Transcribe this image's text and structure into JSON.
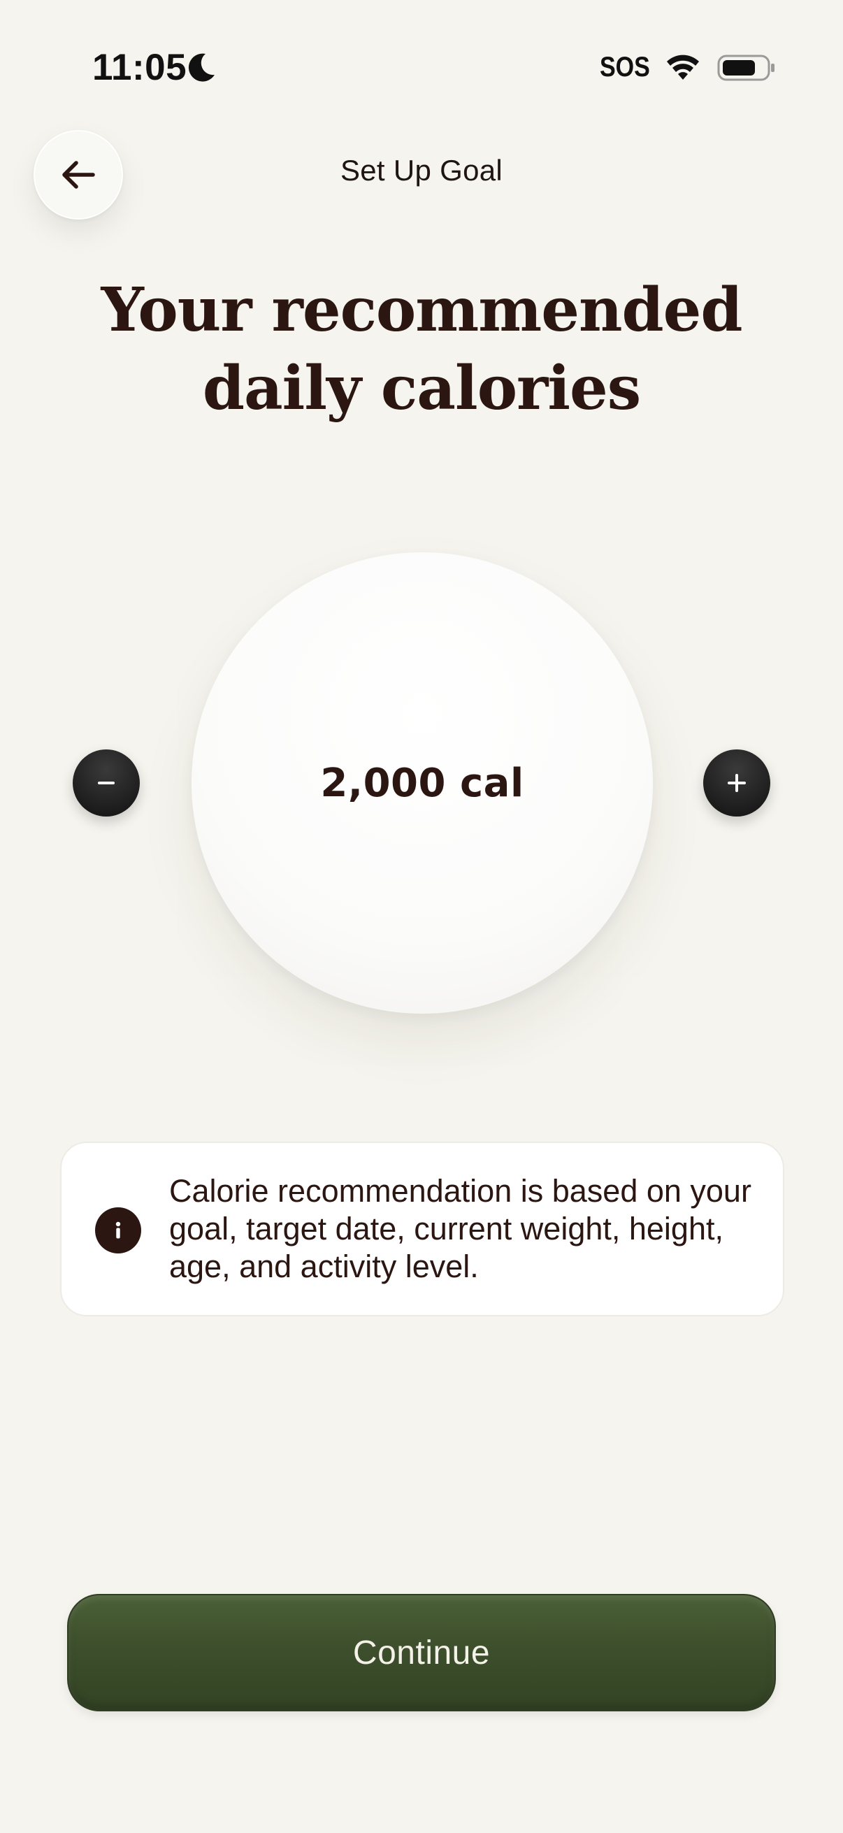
{
  "status_bar": {
    "time": "11:05",
    "carrier_text": "SOS",
    "icons": [
      "moon-icon",
      "wifi-icon",
      "battery-icon"
    ]
  },
  "header": {
    "title": "Set Up Goal",
    "back_icon": "arrow-left-icon"
  },
  "main": {
    "headline": "Your recommended daily calories",
    "calorie_value": "2,000 cal",
    "decrease_label": "−",
    "increase_label": "+",
    "info_text": "Calorie recommendation is based on your goal, target date, current weight, height, age, and activity level."
  },
  "footer": {
    "continue_label": "Continue"
  },
  "colors": {
    "background": "#f5f4ee",
    "text_primary": "#2c1612",
    "button_primary": "#3d4f2c",
    "stepper": "#1d1d1d"
  }
}
